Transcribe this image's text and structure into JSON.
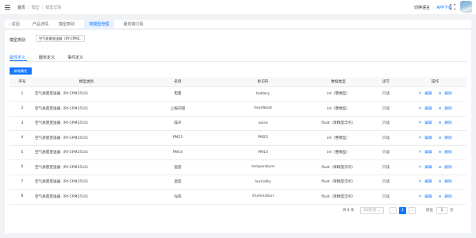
{
  "header": {
    "breadcrumb": [
      "首页",
      "模型",
      "模型详情"
    ],
    "language_label": "切换语言",
    "app_download": "APP下载"
  },
  "tabs": [
    {
      "label": "返回",
      "active": false
    },
    {
      "label": "产品详情",
      "active": false
    },
    {
      "label": "模型类别",
      "active": false
    },
    {
      "label": "物模型管理",
      "active": true
    },
    {
      "label": "服务端订阅",
      "active": false
    }
  ],
  "model_type": {
    "label": "模型类别",
    "value": "空气质量变送器（RY-CPM2"
  },
  "subtabs": [
    {
      "label": "属性定义",
      "active": true
    },
    {
      "label": "服务定义",
      "active": false
    },
    {
      "label": "事件定义",
      "active": false
    }
  ],
  "add_button": "新增属性",
  "table": {
    "columns": [
      "序号",
      "模型类别",
      "名称",
      "标识符",
      "数据类型",
      "读写",
      "操作"
    ],
    "rows": [
      {
        "no": "1",
        "category": "空气质量变送器（RY-CPM2516）",
        "name": "电量",
        "id": "battery",
        "type": "int（整数型）",
        "rw": "只读"
      },
      {
        "no": "2",
        "category": "空气质量变送器（RY-CPM2516）",
        "name": "上报间隔",
        "id": "heartbeat",
        "type": "int（整数型）",
        "rw": "只读"
      },
      {
        "no": "3",
        "category": "空气质量变送器（RY-CPM2516）",
        "name": "噪声",
        "id": "noise",
        "type": "float（单精度浮点）",
        "rw": "只读"
      },
      {
        "no": "4",
        "category": "空气质量变送器（RY-CPM2516）",
        "name": "PM25",
        "id": "PM25",
        "type": "int（整数型）",
        "rw": "只读"
      },
      {
        "no": "5",
        "category": "空气质量变送器（RY-CPM2516）",
        "name": "PM10",
        "id": "PM10",
        "type": "int（整数型）",
        "rw": "只读"
      },
      {
        "no": "6",
        "category": "空气质量变送器（RY-CPM2516）",
        "name": "温度",
        "id": "temperature",
        "type": "float（单精度浮点）",
        "rw": "只读"
      },
      {
        "no": "7",
        "category": "空气质量变送器（RY-CPM2516）",
        "name": "湿度",
        "id": "humidity",
        "type": "float（单精度浮点）",
        "rw": "只读"
      },
      {
        "no": "8",
        "category": "空气质量变送器（RY-CPM2516）",
        "name": "光照",
        "id": "illumination",
        "type": "float（单精度浮点）",
        "rw": "只读"
      }
    ],
    "edit_label": "编辑",
    "delete_label": "删除"
  },
  "pagination": {
    "total": "共 8 条",
    "page_size": "10条/页",
    "current": "1",
    "goto_label": "前往",
    "goto_value": "1",
    "page_unit": "页"
  },
  "colors": {
    "accent": "#1677ff"
  }
}
